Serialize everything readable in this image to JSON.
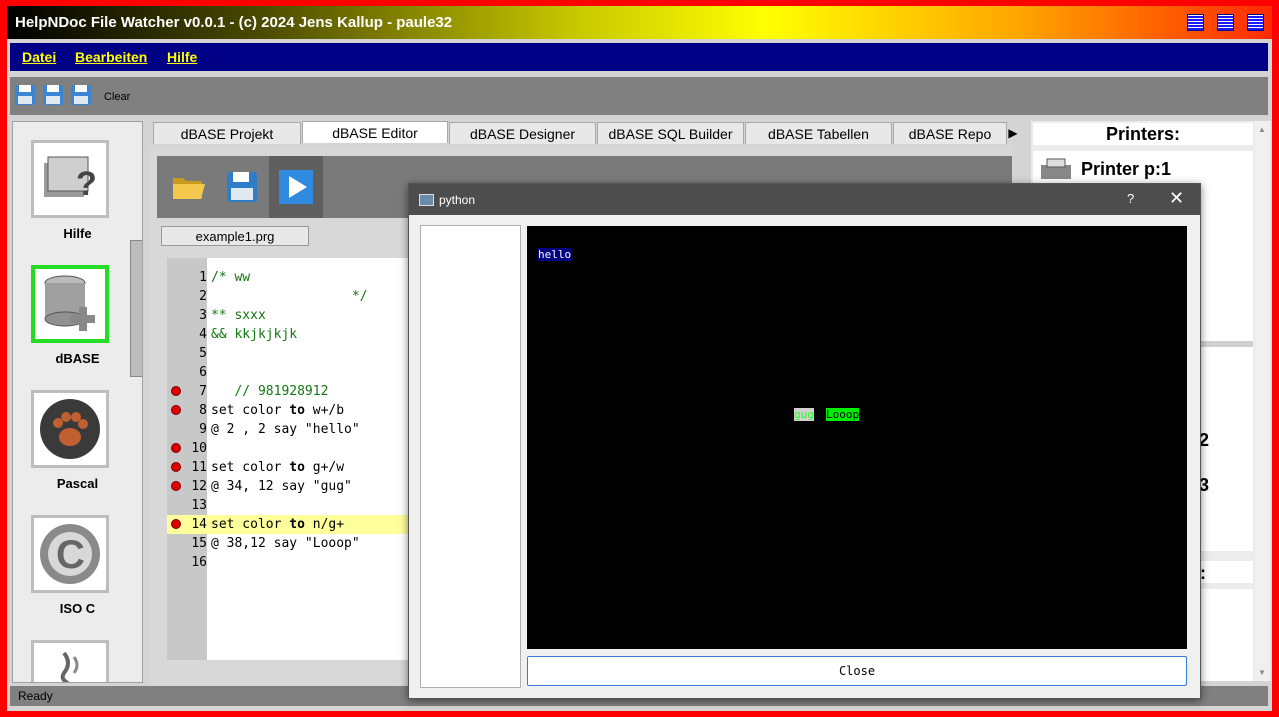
{
  "window": {
    "title": "HelpNDoc File Watcher v0.0.1 - (c) 2024 Jens Kallup - paule32"
  },
  "menu": {
    "items": [
      "Datei",
      "Bearbeiten",
      "Hilfe"
    ]
  },
  "toolbar": {
    "clear_label": "Clear"
  },
  "status": {
    "text": "Ready"
  },
  "sidebar": {
    "items": [
      {
        "label": "Hilfe",
        "icon": "help-book-icon"
      },
      {
        "label": "dBASE",
        "icon": "database-icon",
        "active": true
      },
      {
        "label": "Pascal",
        "icon": "paw-icon"
      },
      {
        "label": "ISO C",
        "icon": "c-language-icon"
      },
      {
        "label": "",
        "icon": "java-icon"
      }
    ]
  },
  "tabs": [
    "dBASE Projekt",
    "dBASE Editor",
    "dBASE Designer",
    "dBASE SQL Builder",
    "dBASE Tabellen",
    "dBASE Repo"
  ],
  "active_tab": "dBASE Editor",
  "editor": {
    "file_tab": "example1.prg",
    "lines": [
      {
        "n": "1",
        "text": "/* ww",
        "bp": false
      },
      {
        "n": "2",
        "text": "                  */",
        "bp": false
      },
      {
        "n": "3",
        "text": "** sxxx",
        "bp": false
      },
      {
        "n": "4",
        "text": "&& kkjkjkjk",
        "bp": false
      },
      {
        "n": "5",
        "text": "",
        "bp": false
      },
      {
        "n": "6",
        "text": "",
        "bp": false
      },
      {
        "n": "7",
        "text": "   // 981928912",
        "bp": true
      },
      {
        "n": "8",
        "text": "set color to w+/b",
        "bp": true
      },
      {
        "n": "9",
        "text": "@ 2 , 2 say \"hello\"",
        "bp": false
      },
      {
        "n": "10",
        "text": "",
        "bp": true
      },
      {
        "n": "11",
        "text": "set color to g+/w",
        "bp": true
      },
      {
        "n": "12",
        "text": "@ 34, 12 say \"gug\"",
        "bp": true
      },
      {
        "n": "13",
        "text": "",
        "bp": false
      },
      {
        "n": "14",
        "text": "set color to n/g+",
        "bp": true,
        "highlight": true
      },
      {
        "n": "15",
        "text": "@ 38,12 say \"Looop\"",
        "bp": false
      },
      {
        "n": "16",
        "text": "",
        "bp": false
      }
    ]
  },
  "right_panel": {
    "title": "Printers:",
    "printer": "Printer p:1",
    "frag1": "2",
    "frag2": "3",
    "frag3": "r:"
  },
  "dialog": {
    "title": "python",
    "help": "?",
    "close_x": "✕",
    "close_label": "Close",
    "terminal": [
      {
        "text": "hello",
        "fg": "#ffffff",
        "bg": "#000080"
      },
      {
        "text": "gug",
        "fg": "#22ff22",
        "bg": "#d0d0d0"
      },
      {
        "text": "Looop",
        "fg": "#000000",
        "bg": "#00ee00"
      }
    ]
  }
}
